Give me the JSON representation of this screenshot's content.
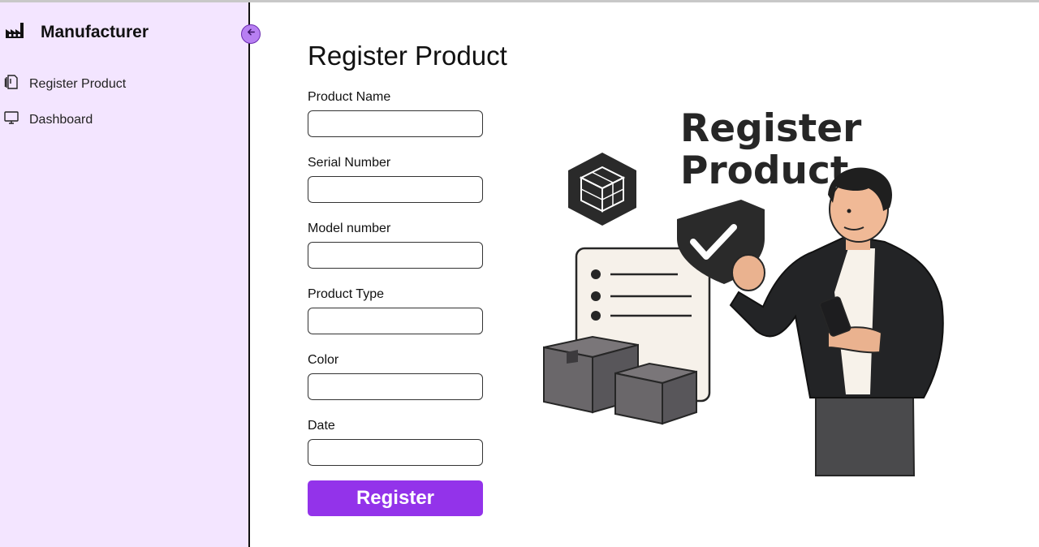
{
  "sidebar": {
    "brand_icon": "factory-icon",
    "title": "Manufacturer",
    "items": [
      {
        "label": "Register Product",
        "icon": "document-icon"
      },
      {
        "label": "Dashboard",
        "icon": "monitor-icon"
      }
    ],
    "collapse_icon": "arrow-left-icon"
  },
  "form": {
    "title": "Register Product",
    "fields": [
      {
        "label": "Product Name",
        "value": ""
      },
      {
        "label": "Serial Number",
        "value": ""
      },
      {
        "label": "Model number",
        "value": ""
      },
      {
        "label": "Product Type",
        "value": ""
      },
      {
        "label": "Color",
        "value": ""
      },
      {
        "label": "Date",
        "value": ""
      }
    ],
    "submit_label": "Register"
  },
  "illustration": {
    "title_line1": "Register",
    "title_line2": "Product"
  },
  "colors": {
    "sidebar_bg": "#f3e5ff",
    "accent": "#9333ea",
    "collapse_button": "#b77ff2"
  }
}
